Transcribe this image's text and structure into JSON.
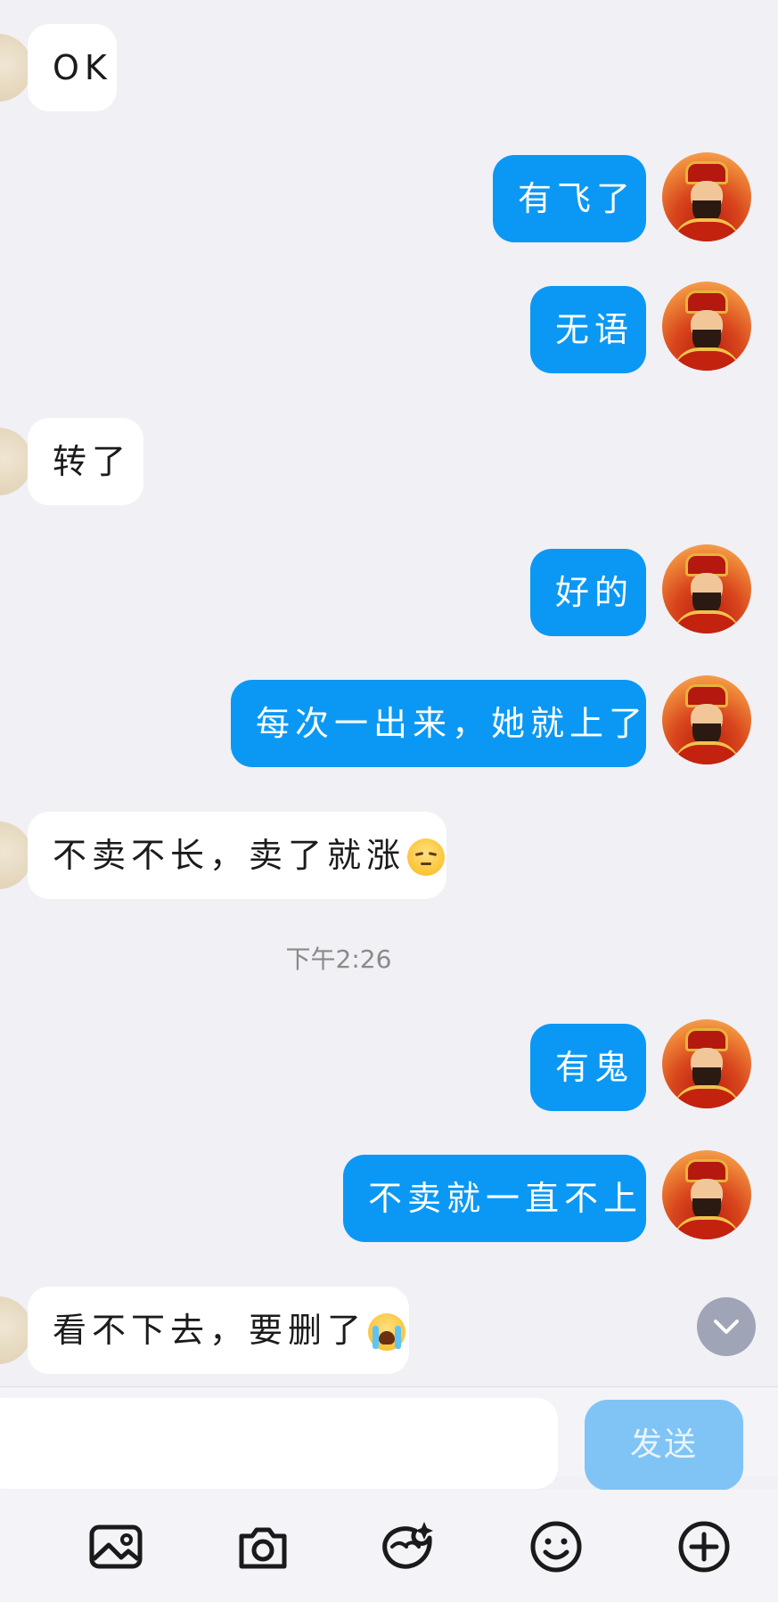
{
  "messages": [
    {
      "side": "in",
      "text": "OK"
    },
    {
      "side": "out",
      "text": "有飞了"
    },
    {
      "side": "out",
      "text": "无语"
    },
    {
      "side": "in",
      "text": "转了"
    },
    {
      "side": "out",
      "text": "好的"
    },
    {
      "side": "out",
      "text": "每次一出来，她就上了"
    },
    {
      "side": "in",
      "text": "不卖不长，卖了就涨",
      "emoji": "pensive-face"
    },
    {
      "side": "out",
      "text": "有鬼"
    },
    {
      "side": "out",
      "text": "不卖就一直不上"
    },
    {
      "side": "in",
      "text": "看不下去，要删了",
      "emoji": "loudly-crying-face"
    }
  ],
  "timestamp": "下午2:26",
  "composer": {
    "value": "",
    "send_label": "发送"
  },
  "toolbar": {
    "icons": [
      "image-icon",
      "camera-icon",
      "sticker-icon",
      "emoji-icon",
      "plus-icon"
    ]
  },
  "colors": {
    "background": "#f0f0f5",
    "outgoing_bubble": "#0b98f4",
    "incoming_bubble": "#ffffff",
    "send_button_disabled": "#80c4f5"
  }
}
